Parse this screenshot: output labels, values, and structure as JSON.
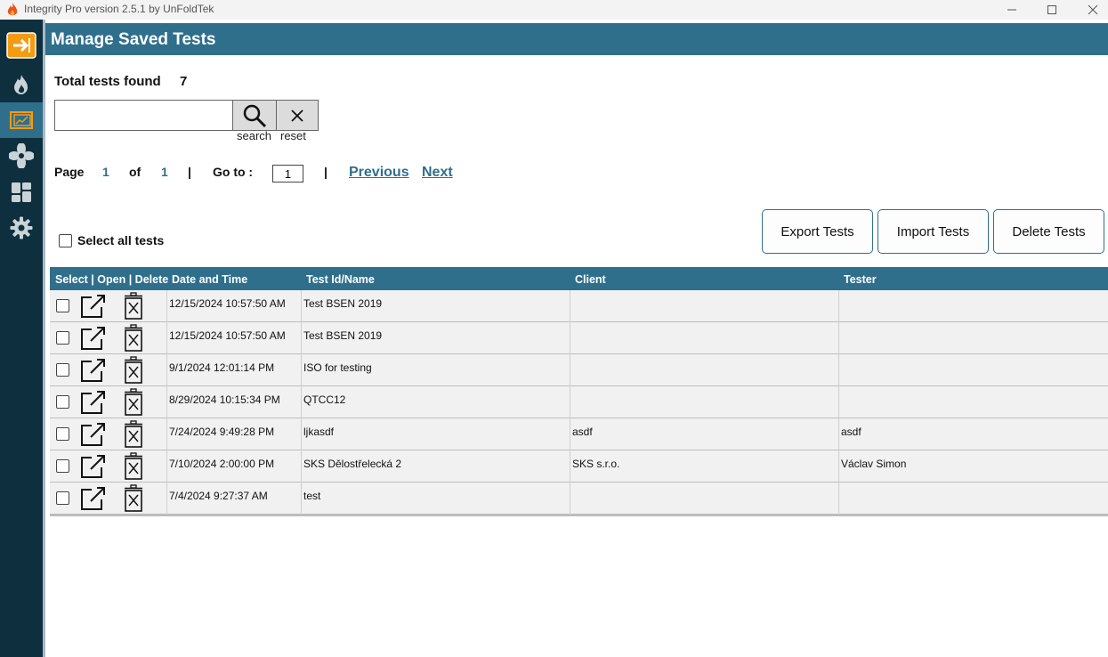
{
  "window": {
    "title": "Integrity Pro version 2.5.1 by UnFoldTek",
    "controls": [
      "minimize-icon",
      "maximize-icon",
      "close-icon"
    ]
  },
  "sidebar": {
    "items": [
      {
        "icon": "exit-arrow-icon",
        "active": false,
        "highlight": "#f39c12"
      },
      {
        "icon": "flame-icon",
        "active": false
      },
      {
        "icon": "charts-icon",
        "active": true
      },
      {
        "icon": "fan-icon",
        "active": false
      },
      {
        "icon": "dashboard-icon",
        "active": false
      },
      {
        "icon": "gear-icon",
        "active": false
      }
    ]
  },
  "header": {
    "title": "Manage Saved Tests"
  },
  "summary": {
    "label": "Total tests found",
    "count": "7"
  },
  "search": {
    "value": "",
    "search_label": "search",
    "reset_label": "reset"
  },
  "pager": {
    "page_label": "Page",
    "page": "1",
    "of_label": "of",
    "total_pages": "1",
    "sep": "|",
    "goto_label": "Go to :",
    "goto_value": "1",
    "previous": "Previous",
    "next": "Next"
  },
  "select_all_label": "Select all tests",
  "actions": {
    "export": "Export Tests",
    "import": "Import Tests",
    "delete": "Delete Tests"
  },
  "table": {
    "headers": {
      "actions": "Select | Open | Delete",
      "datetime": "Date and Time",
      "name": "Test Id/Name",
      "client": "Client",
      "tester": "Tester"
    },
    "rows": [
      {
        "datetime": "12/15/2024 10:57:50 AM",
        "name": "Test BSEN 2019",
        "client": "",
        "tester": ""
      },
      {
        "datetime": "12/15/2024 10:57:50 AM",
        "name": "Test BSEN 2019",
        "client": "",
        "tester": ""
      },
      {
        "datetime": "9/1/2024 12:01:14 PM",
        "name": "ISO for testing",
        "client": "",
        "tester": ""
      },
      {
        "datetime": "8/29/2024 10:15:34 PM",
        "name": "QTCC12",
        "client": "",
        "tester": ""
      },
      {
        "datetime": "7/24/2024 9:49:28 PM",
        "name": "ljkasdf",
        "client": "asdf",
        "tester": "asdf"
      },
      {
        "datetime": "7/10/2024 2:00:00 PM",
        "name": "SKS Dělostřelecká 2",
        "client": "SKS s.r.o.",
        "tester": "Václav Simon"
      },
      {
        "datetime": "7/4/2024 9:27:37 AM",
        "name": "test",
        "client": "",
        "tester": ""
      }
    ]
  },
  "colors": {
    "accent": "#2f6f8c",
    "sidebar": "#0e2f3d",
    "highlight": "#f39c12"
  }
}
